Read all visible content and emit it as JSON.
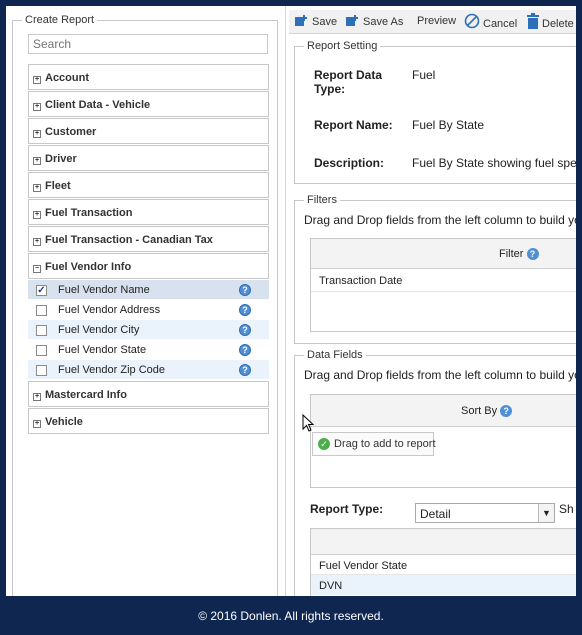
{
  "left": {
    "legend": "Create Report",
    "search_placeholder": "Search",
    "categories": [
      "Account",
      "Client Data - Vehicle",
      "Customer",
      "Driver",
      "Fleet",
      "Fuel Transaction",
      "Fuel Transaction - Canadian Tax",
      "Fuel Vendor Info",
      "Mastercard Info",
      "Vehicle"
    ],
    "fuel_vendor_fields": [
      {
        "label": "Fuel Vendor Name",
        "checked": true
      },
      {
        "label": "Fuel Vendor Address",
        "checked": false
      },
      {
        "label": "Fuel Vendor City",
        "checked": false
      },
      {
        "label": "Fuel Vendor State",
        "checked": false
      },
      {
        "label": "Fuel Vendor Zip Code",
        "checked": false
      }
    ]
  },
  "toolbar": {
    "save": "Save",
    "save_as": "Save As",
    "preview": "Preview",
    "cancel": "Cancel",
    "delete": "Delete"
  },
  "report_setting": {
    "legend": "Report Setting",
    "data_type_label": "Report Data Type:",
    "data_type_value": "Fuel",
    "name_label": "Report Name:",
    "name_value": "Fuel By State",
    "description_label": "Description:",
    "description_value": "Fuel By State showing fuel spen"
  },
  "filters": {
    "legend": "Filters",
    "hint": "Drag and Drop fields from the left column to build yo",
    "column_header": "Filter",
    "rows": [
      "Transaction Date"
    ]
  },
  "data_fields": {
    "legend": "Data Fields",
    "hint": "Drag and Drop fields from the left column to build yo",
    "sort_header": "Sort By",
    "drag_tip": "Drag to add to report",
    "report_type_label": "Report Type:",
    "report_type_value": "Detail",
    "trailing_label": "Sh",
    "rows": [
      "Fuel Vendor State",
      "DVN"
    ]
  },
  "footer": "© 2016 Donlen. All rights reserved."
}
